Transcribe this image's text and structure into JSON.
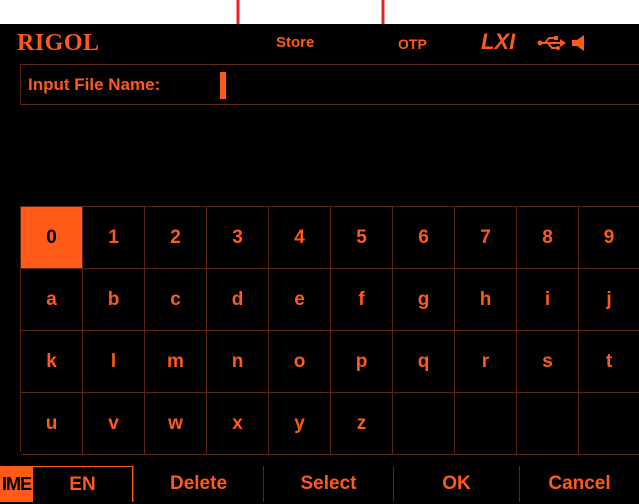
{
  "status_bar": {
    "brand": "RIGOL",
    "mode": "Store",
    "otp": "OTP",
    "lxi": "LXI",
    "icons": [
      "usb-icon",
      "speaker-icon"
    ]
  },
  "input": {
    "label": "Input File Name:",
    "value": ""
  },
  "keyboard": {
    "rows": [
      [
        "0",
        "1",
        "2",
        "3",
        "4",
        "5",
        "6",
        "7",
        "8",
        "9"
      ],
      [
        "a",
        "b",
        "c",
        "d",
        "e",
        "f",
        "g",
        "h",
        "i",
        "j"
      ],
      [
        "k",
        "l",
        "m",
        "n",
        "o",
        "p",
        "q",
        "r",
        "s",
        "t"
      ],
      [
        "u",
        "v",
        "w",
        "x",
        "y",
        "z",
        "",
        "",
        "",
        ""
      ]
    ],
    "selected": "0"
  },
  "softkeys": {
    "ime_tag": "IME",
    "ime_value": "EN",
    "delete": "Delete",
    "select": "Select",
    "ok": "OK",
    "cancel": "Cancel"
  },
  "colors": {
    "accent": "#ff5a17",
    "background": "#000000",
    "grid": "#5a2810",
    "annotation_arrow": "#e8202a"
  }
}
